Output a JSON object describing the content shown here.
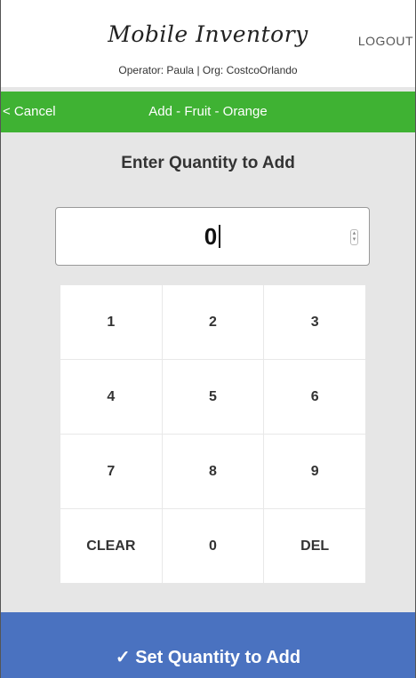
{
  "header": {
    "app_title": "Mobile Inventory",
    "operator_line": "Operator: Paula | Org: CostcoOrlando",
    "logout_label": "LOGOUT"
  },
  "nav_bar": {
    "cancel_label": "< Cancel",
    "title": "Add - Fruit - Orange",
    "background_color": "#3fb233"
  },
  "main": {
    "prompt": "Enter Quantity to Add",
    "quantity_value": "0"
  },
  "keypad": {
    "keys": [
      "1",
      "2",
      "3",
      "4",
      "5",
      "6",
      "7",
      "8",
      "9",
      "CLEAR",
      "0",
      "DEL"
    ]
  },
  "footer": {
    "submit_label": "✓ Set Quantity to Add",
    "background_color": "#4a72c0"
  }
}
